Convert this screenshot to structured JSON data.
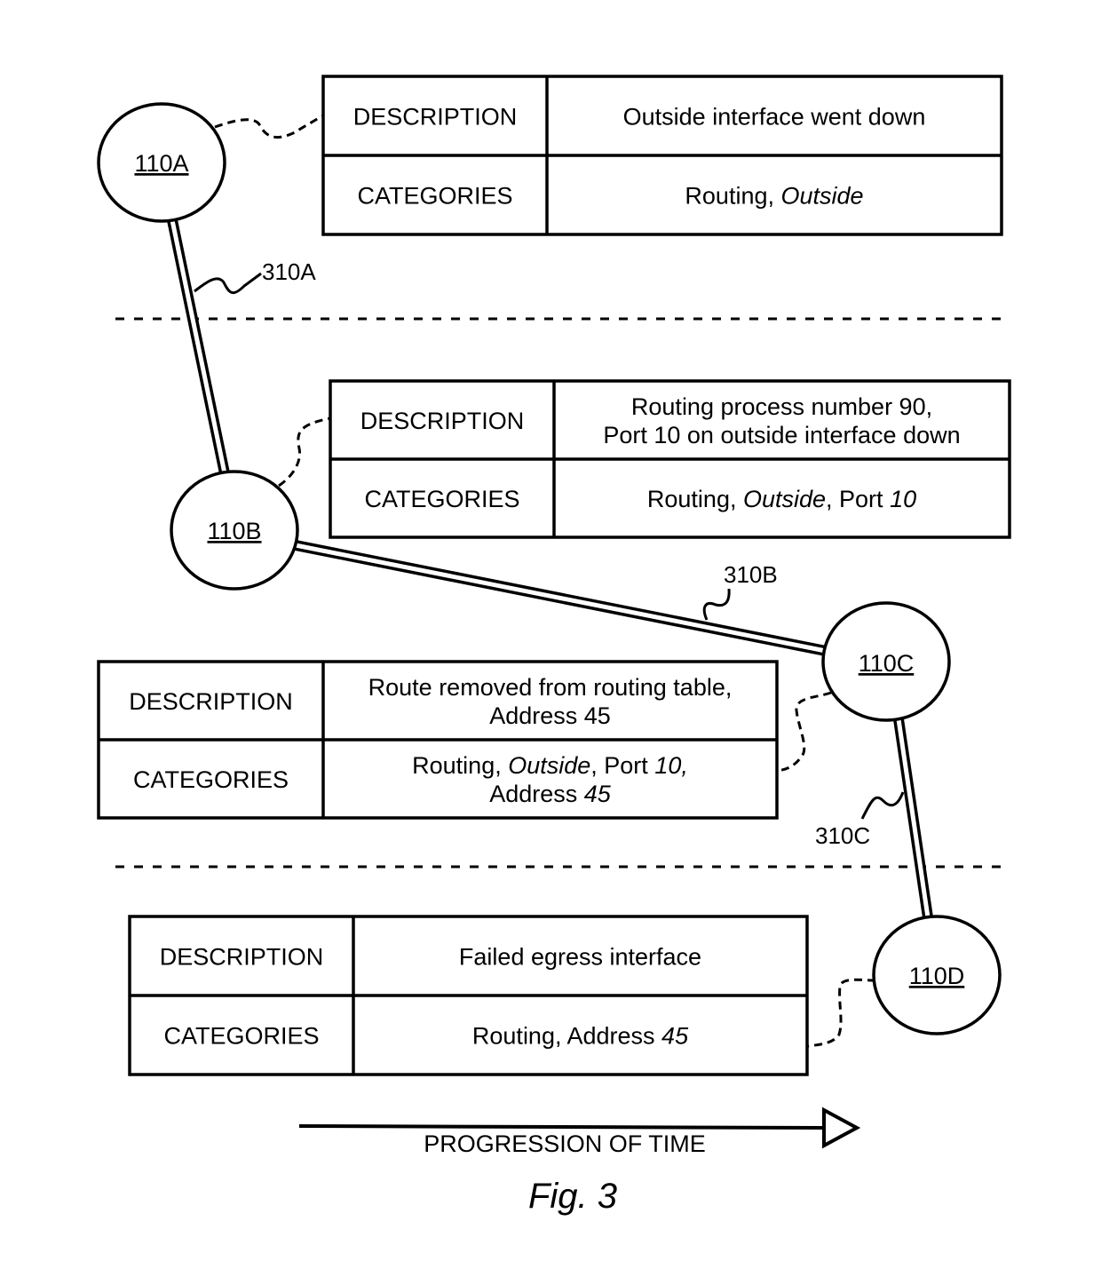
{
  "figure": {
    "caption": "Fig. 3",
    "timeline_label": "PROGRESSION OF TIME"
  },
  "nodes": [
    {
      "id": "110A",
      "label": "110A"
    },
    {
      "id": "110B",
      "label": "110B"
    },
    {
      "id": "110C",
      "label": "110C"
    },
    {
      "id": "110D",
      "label": "110D"
    }
  ],
  "links": [
    {
      "id": "310A",
      "label": "310A",
      "from": "110A",
      "to": "110B"
    },
    {
      "id": "310B",
      "label": "310B",
      "from": "110B",
      "to": "110C"
    },
    {
      "id": "310C",
      "label": "310C",
      "from": "110C",
      "to": "110D"
    }
  ],
  "tables": [
    {
      "node": "110A",
      "description_header": "DESCRIPTION",
      "categories_header": "CATEGORIES",
      "description_lines": [
        "Outside interface went down"
      ],
      "categories_lines": [
        [
          {
            "t": "Routing, ",
            "i": false
          },
          {
            "t": "Outside",
            "i": true
          }
        ]
      ]
    },
    {
      "node": "110B",
      "description_header": "DESCRIPTION",
      "categories_header": "CATEGORIES",
      "description_lines": [
        "Routing process number 90,",
        "Port 10 on outside interface down"
      ],
      "categories_lines": [
        [
          {
            "t": "Routing, ",
            "i": false
          },
          {
            "t": "Outside",
            "i": true
          },
          {
            "t": ", Port ",
            "i": false
          },
          {
            "t": "10",
            "i": true
          }
        ]
      ]
    },
    {
      "node": "110C",
      "description_header": "DESCRIPTION",
      "categories_header": "CATEGORIES",
      "description_lines": [
        "Route removed from routing table,",
        "Address 45"
      ],
      "categories_lines": [
        [
          {
            "t": "Routing, ",
            "i": false
          },
          {
            "t": "Outside",
            "i": true
          },
          {
            "t": ", Port ",
            "i": false
          },
          {
            "t": "10,",
            "i": true
          }
        ],
        [
          {
            "t": "Address ",
            "i": false
          },
          {
            "t": "45",
            "i": true
          }
        ]
      ]
    },
    {
      "node": "110D",
      "description_header": "DESCRIPTION",
      "categories_header": "CATEGORIES",
      "description_lines": [
        "Failed egress interface"
      ],
      "categories_lines": [
        [
          {
            "t": "Routing, Address ",
            "i": false
          },
          {
            "t": "45",
            "i": true
          }
        ]
      ]
    }
  ]
}
